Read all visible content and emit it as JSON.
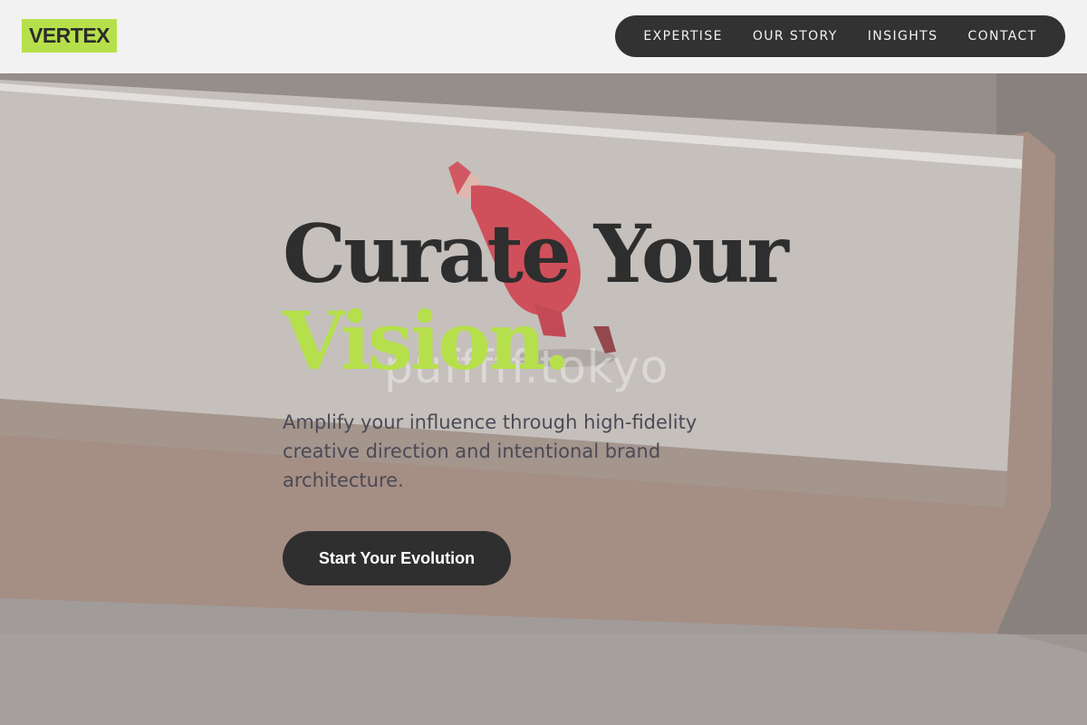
{
  "brand": {
    "logo_text": "VERTEX",
    "accent_color": "#b6e04b"
  },
  "nav": {
    "items": [
      {
        "label": "EXPERTISE"
      },
      {
        "label": "OUR STORY"
      },
      {
        "label": "INSIGHTS"
      },
      {
        "label": "CONTACT"
      }
    ]
  },
  "hero": {
    "headline_line1": "Curate Your",
    "headline_line2": "Vision.",
    "watermark": "pufffff.tokyo",
    "subtext": "Amplify your influence through high-fidelity creative direction and intentional brand architecture.",
    "cta_label": "Start Your Evolution",
    "colors": {
      "headline": "#2e2e2e",
      "cta_background": "#2f2f2f",
      "nav_background": "#323232"
    }
  }
}
